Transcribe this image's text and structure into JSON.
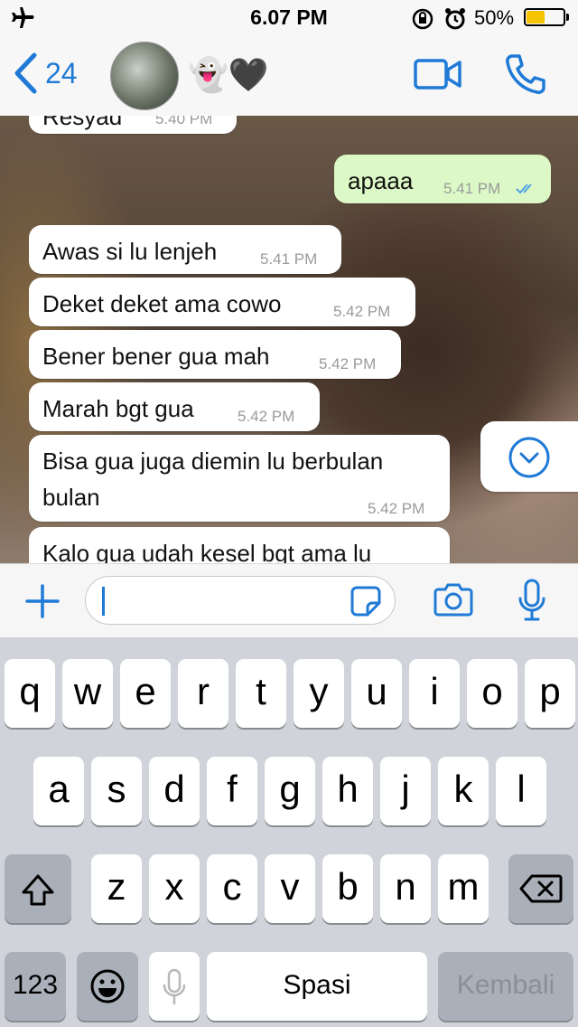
{
  "status": {
    "time": "6.07 PM",
    "battery_pct": "50%",
    "battery_level": 0.5
  },
  "header": {
    "back_count": "24",
    "contact_name_emoji": "👻🖤"
  },
  "messages": [
    {
      "text": "Resyad",
      "time": "5.40 PM",
      "direction": "in"
    },
    {
      "text": "apaaa",
      "time": "5.41 PM",
      "direction": "out"
    },
    {
      "text": "Awas si lu lenjeh",
      "time": "5.41 PM",
      "direction": "in"
    },
    {
      "text": "Deket deket ama cowo",
      "time": "5.42 PM",
      "direction": "in"
    },
    {
      "text": "Bener bener gua mah",
      "time": "5.42 PM",
      "direction": "in"
    },
    {
      "text": "Marah bgt gua",
      "time": "5.42 PM",
      "direction": "in"
    },
    {
      "text_line1": "Bisa gua juga diemin lu berbulan",
      "text_line2": "bulan",
      "time": "5.42 PM",
      "direction": "in"
    },
    {
      "text": "Kalo gua udah kesel bgt ama lu",
      "direction": "in"
    }
  ],
  "keyboard": {
    "row1": [
      "q",
      "w",
      "e",
      "r",
      "t",
      "y",
      "u",
      "i",
      "o",
      "p"
    ],
    "row2": [
      "a",
      "s",
      "d",
      "f",
      "g",
      "h",
      "j",
      "k",
      "l"
    ],
    "row3": [
      "z",
      "x",
      "c",
      "v",
      "b",
      "n",
      "m"
    ],
    "numbers_label": "123",
    "space_label": "Spasi",
    "return_label": "Kembali"
  },
  "colors": {
    "accent": "#1f7ad6",
    "outgoing_bubble": "#dcf8c6",
    "incoming_bubble": "#ffffff"
  }
}
